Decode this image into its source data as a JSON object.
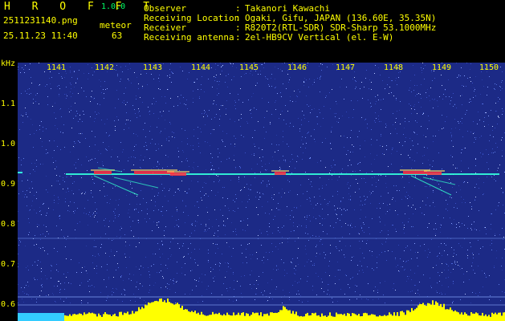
{
  "app": {
    "title": "H R O F F T",
    "version": "1.0.0"
  },
  "capture": {
    "filename": "2511231140.png",
    "label": "meteor",
    "datetime": "25.11.23 11:40",
    "count": "63"
  },
  "info": [
    {
      "key": "Observer",
      "value": "Takanori Kawachi"
    },
    {
      "key": "Receiving Location",
      "value": "Ogaki, Gifu, JAPAN (136.60E, 35.35N)"
    },
    {
      "key": "Receiver",
      "value": "R820T2(RTL-SDR) SDR-Sharp 53.1000MHz"
    },
    {
      "key": "Receiving antenna",
      "value": "2el-HB9CV Vertical (el. E-W)"
    }
  ],
  "separator": ":",
  "axis": {
    "unit": "kHz",
    "y_ticks": [
      "1.1",
      "1.0",
      "0.9",
      "0.8",
      "0.7",
      "0.6"
    ],
    "x_ticks": [
      "1141",
      "1142",
      "1143",
      "1144",
      "1145",
      "1146",
      "1147",
      "1148",
      "1149",
      "1150"
    ]
  },
  "colors": {
    "background": "#000000",
    "text": "#ffff00",
    "version": "#00ff66",
    "spectrogram_base": "#1c2a86",
    "signal_line": "#33ffdd",
    "meteor_hot": "#ff3040",
    "histogram": "#ffff00",
    "histogram_left": "#33ccff"
  }
}
